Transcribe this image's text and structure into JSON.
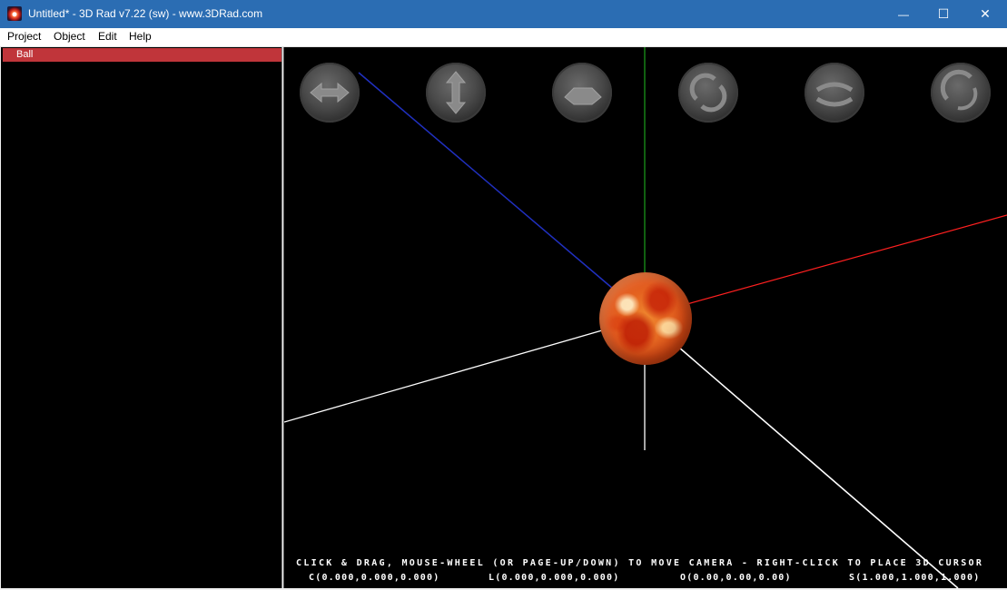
{
  "window": {
    "title": "Untitled* - 3D Rad v7.22 (sw) - www.3DRad.com",
    "minimize_glyph": "—",
    "maximize_glyph": "☐",
    "close_glyph": "✕"
  },
  "menu": {
    "project": "Project",
    "object": "Object",
    "edit": "Edit",
    "help": "Help"
  },
  "object_list": {
    "items": [
      {
        "label": "Ball",
        "selected": true
      }
    ]
  },
  "viewport": {
    "nav_buttons": [
      "move-left-right-icon",
      "move-up-down-icon",
      "move-plane-icon",
      "rotate-x-icon",
      "rotate-y-icon",
      "rotate-z-icon"
    ],
    "axis_colors": {
      "x": "#ff2020",
      "y": "#20c020",
      "z": "#2030c0",
      "grid": "#ffffff"
    },
    "hint": "CLICK & DRAG, MOUSE-WHEEL (OR PAGE-UP/DOWN) TO MOVE CAMERA - RIGHT-CLICK TO PLACE 3D CURSOR",
    "coords": {
      "c": "C(0.000,0.000,0.000)",
      "l": "L(0.000,0.000,0.000)",
      "o": "O(0.00,0.00,0.00)",
      "s": "S(1.000,1.000,1.000)"
    }
  }
}
